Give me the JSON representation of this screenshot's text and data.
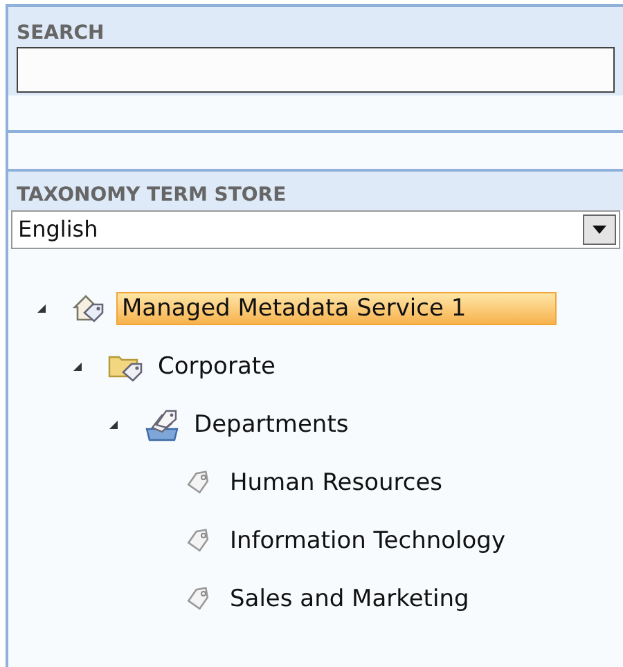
{
  "search": {
    "heading": "SEARCH"
  },
  "term_store": {
    "heading": "TAXONOMY TERM STORE",
    "language": "English"
  },
  "tree": [
    {
      "kind": "service",
      "label": "Managed Metadata Service 1",
      "selected": true,
      "expanded": true,
      "children": [
        {
          "kind": "group",
          "label": "Corporate",
          "selected": false,
          "expanded": true,
          "children": [
            {
              "kind": "termset",
              "label": "Departments",
              "selected": false,
              "expanded": true,
              "children": [
                {
                  "kind": "term",
                  "label": "Human Resources",
                  "selected": false
                },
                {
                  "kind": "term",
                  "label": "Information Technology",
                  "selected": false
                },
                {
                  "kind": "term",
                  "label": "Sales and Marketing",
                  "selected": false
                }
              ]
            }
          ]
        }
      ]
    }
  ]
}
